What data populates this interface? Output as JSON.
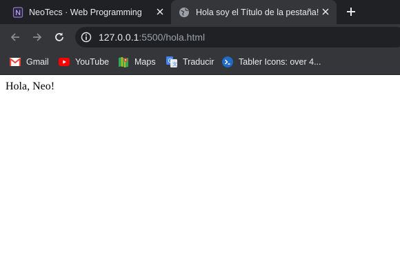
{
  "tabs": [
    {
      "title": "NeoTecs · Web Programming",
      "icon": "notion-n-icon",
      "active": false
    },
    {
      "title": "Hola soy el Título de la pestaña!",
      "icon": "globe-icon",
      "active": true
    }
  ],
  "toolbar": {
    "url_host": "127.0.0.1",
    "url_rest": ":5500/hola.html"
  },
  "bookmarks": [
    {
      "label": "Gmail",
      "icon": "gmail-icon"
    },
    {
      "label": "YouTube",
      "icon": "youtube-icon"
    },
    {
      "label": "Maps",
      "icon": "maps-icon"
    },
    {
      "label": "Traducir",
      "icon": "translate-icon"
    },
    {
      "label": "Tabler Icons: over 4...",
      "icon": "tabler-icon"
    }
  ],
  "page": {
    "text": "Hola, Neo!"
  },
  "colors": {
    "tabstrip_bg": "#202124",
    "toolbar_bg": "#35363a",
    "omnibox_bg": "#202124",
    "text": "#e8eaed"
  }
}
